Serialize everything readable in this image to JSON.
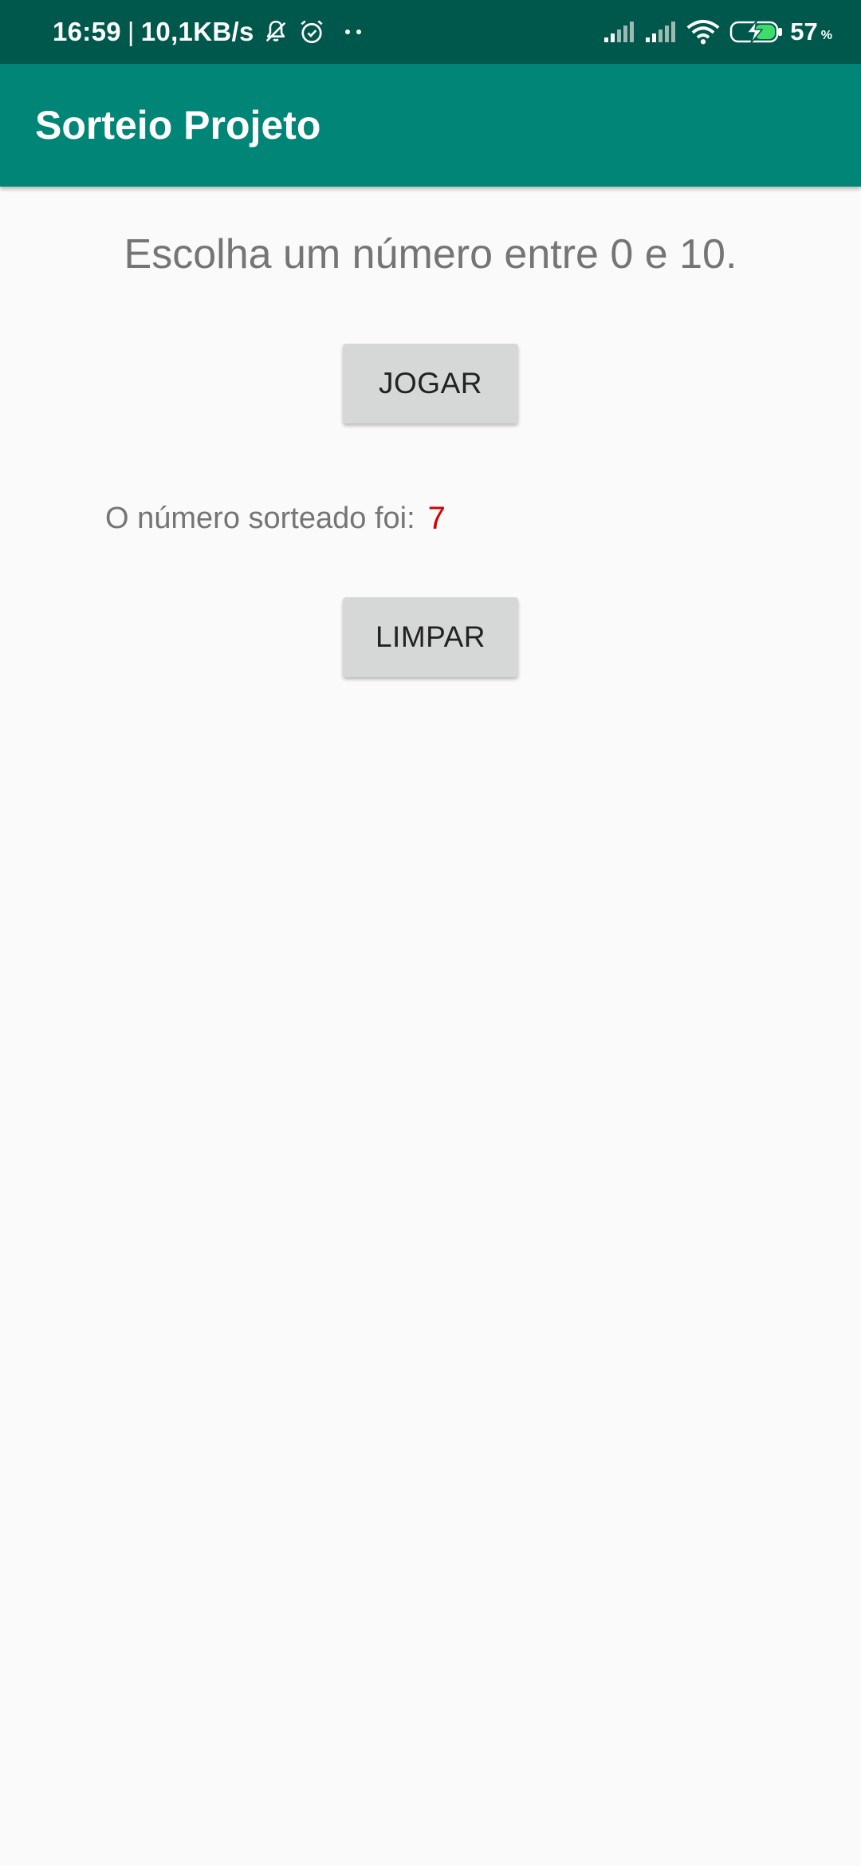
{
  "status_bar": {
    "time": "16:59",
    "separator": "|",
    "network_speed": "10,1KB/s",
    "left_icons": [
      "bell-muted-icon",
      "alarm-icon",
      "more-dots-icon"
    ],
    "right_icons": [
      "signal-icon",
      "signal-icon",
      "wifi-icon",
      "battery-charging-icon"
    ],
    "battery_percent": "57",
    "battery_percent_unit": "%"
  },
  "app_bar": {
    "title": "Sorteio Projeto",
    "color": "#008577"
  },
  "main": {
    "instruction": "Escolha um número entre 0 e 10.",
    "play_button": "JOGAR",
    "result_label": "O número sorteado foi:",
    "result_value": "7",
    "clear_button": "LIMPAR"
  },
  "colors": {
    "status_bar": "#00574b",
    "app_bar": "#008577",
    "result_value": "#d50000",
    "button": "#d6d7d7"
  }
}
